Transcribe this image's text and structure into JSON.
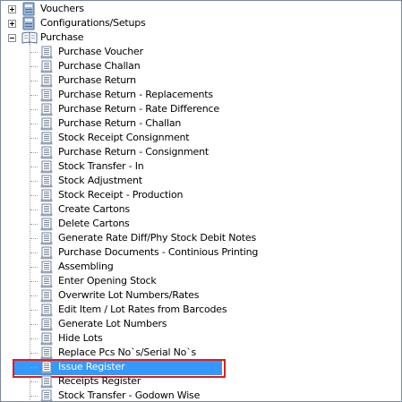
{
  "tree": {
    "top_nodes": [
      {
        "label": "Vouchers",
        "icon": "database-icon",
        "expander": "plus"
      },
      {
        "label": "Configurations/Setups",
        "icon": "database-icon",
        "expander": "plus"
      },
      {
        "label": "Purchase",
        "icon": "book-icon",
        "expander": "minus"
      }
    ],
    "purchase_children": [
      "Purchase Voucher",
      "Purchase Challan",
      "Purchase Return",
      "Purchase Return - Replacements",
      "Purchase Return - Rate Difference",
      "Purchase Return - Challan",
      "Stock Receipt Consignment",
      "Purchase Return - Consignment",
      "Stock Transfer - In",
      "Stock Adjustment",
      "Stock Receipt - Production",
      "Create Cartons",
      "Delete Cartons",
      "Generate Rate Diff/Phy Stock Debit Notes",
      "Purchase Documents - Continious Printing",
      "Assembling",
      "Enter Opening Stock",
      "Overwrite Lot Numbers/Rates",
      "Edit Item / Lot Rates from Barcodes",
      "Generate Lot Numbers",
      "Hide Lots",
      "Replace Pcs No`s/Serial No`s",
      "Issue Register",
      "Receipts Register",
      "Stock Transfer - Godown Wise"
    ],
    "selected_index": 22,
    "colors": {
      "selection": "#3399ff",
      "highlight_outline": "#e21b1b"
    }
  }
}
